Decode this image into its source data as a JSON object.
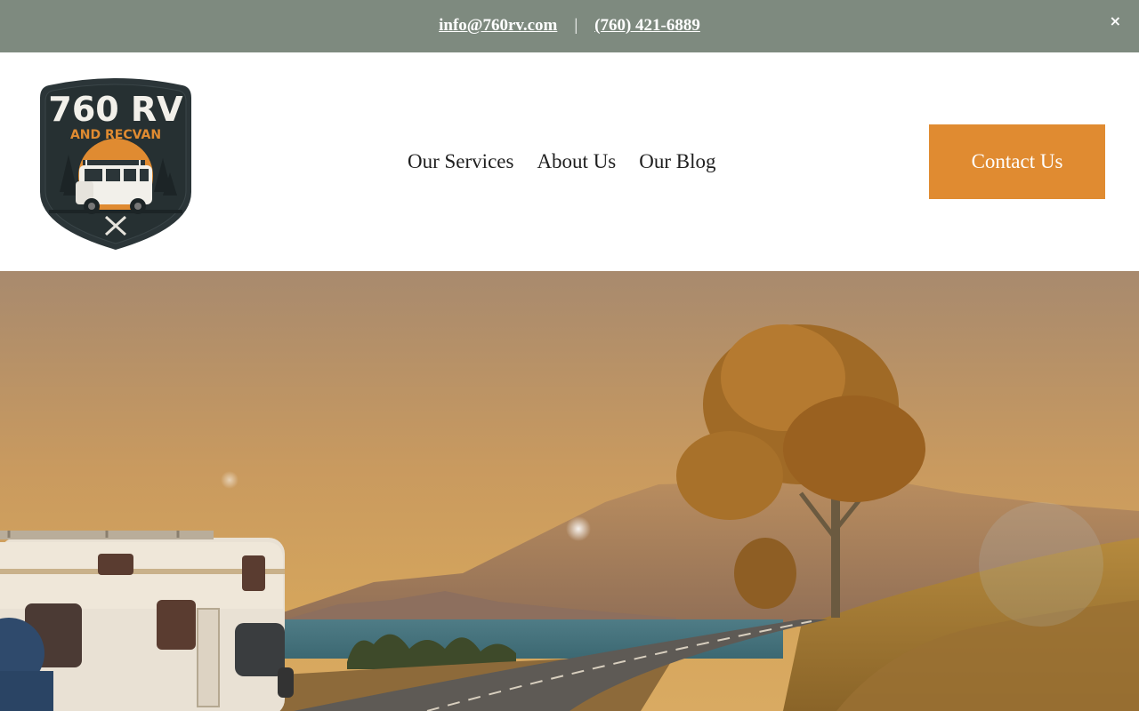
{
  "announcement": {
    "email": "info@760rv.com",
    "separator": "|",
    "phone": "(760) 421-6889",
    "close_symbol": "×"
  },
  "logo": {
    "title": "760 RV",
    "subtitle": "AND RECVAN"
  },
  "nav": {
    "items": [
      "Our Services",
      "About Us",
      "Our Blog"
    ]
  },
  "cta": {
    "label": "Contact Us"
  },
  "colors": {
    "topbar": "#7e8a7f",
    "accent": "#e08b31",
    "logo_dark": "#263032"
  },
  "hero": {
    "image_subject": "rv-parked-by-coastal-road-at-sunset"
  }
}
